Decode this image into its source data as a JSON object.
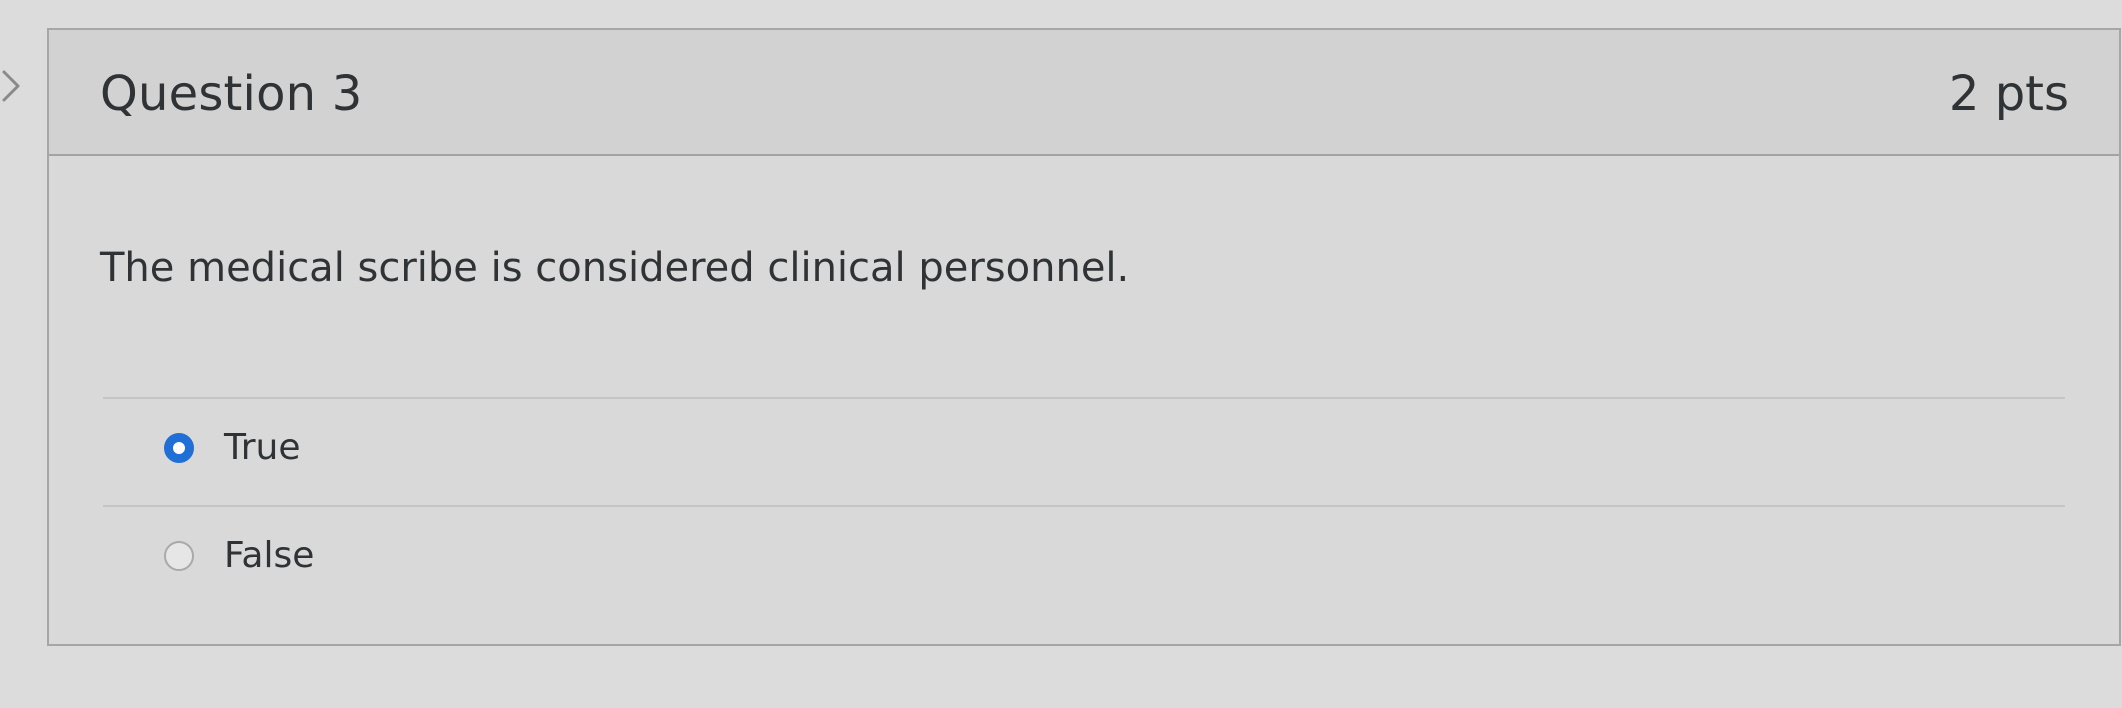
{
  "question": {
    "title": "Question 3",
    "points": "2 pts",
    "text": "The medical scribe is considered clinical personnel.",
    "answers": [
      {
        "label": "True",
        "selected": true
      },
      {
        "label": "False",
        "selected": false
      }
    ]
  },
  "colors": {
    "radio_selected": "#1f6fd6",
    "text": "#2f3336"
  },
  "icons": {
    "side_toggle": "chevron-right-icon"
  }
}
